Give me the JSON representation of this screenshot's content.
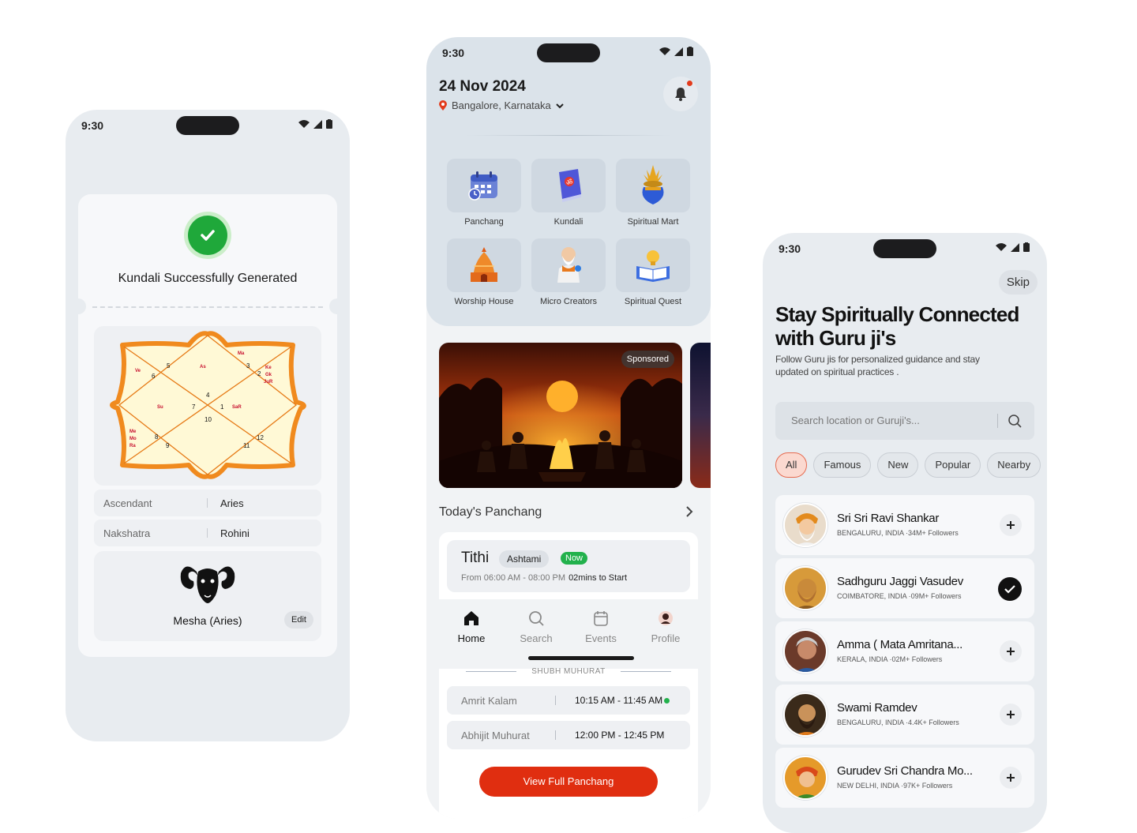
{
  "status": {
    "time": "9:30"
  },
  "kundali": {
    "title": "Kundali Successfully Generated",
    "rows": [
      {
        "label": "Ascendant",
        "value": "Aries"
      },
      {
        "label": "Nakshatra",
        "value": "Rohini"
      }
    ],
    "sign": "Mesha (Aries)",
    "edit_label": "Edit",
    "houses": [
      "1",
      "2",
      "3",
      "4",
      "5",
      "6",
      "7",
      "8",
      "9",
      "10",
      "11",
      "12"
    ],
    "planets": [
      "Ma",
      "Ve",
      "As",
      "Ke",
      "Gk",
      "JuR",
      "Su",
      "SaR",
      "Me",
      "Mo",
      "Ra"
    ]
  },
  "home": {
    "date": "24 Nov 2024",
    "location": "Bangalore, Karnataka",
    "tiles": [
      {
        "label": "Panchang",
        "icon": "calendar-icon"
      },
      {
        "label": "Kundali",
        "icon": "book-icon"
      },
      {
        "label": "Spiritual Mart",
        "icon": "kalash-icon"
      },
      {
        "label": "Worship House",
        "icon": "temple-icon"
      },
      {
        "label": "Micro Creators",
        "icon": "guru-figure-icon"
      },
      {
        "label": "Spiritual Quest",
        "icon": "quest-book-icon"
      }
    ],
    "sponsored": "Sponsored",
    "panchang_title": "Today's Panchang",
    "tithi": {
      "label": "Tithi",
      "value": "Ashtami",
      "now": "Now",
      "time": "From 06:00 AM - 08:00 PM",
      "start": "02mins to Start"
    },
    "nav": [
      {
        "label": "Home",
        "icon": "home-icon",
        "active": true
      },
      {
        "label": "Search",
        "icon": "search-icon",
        "active": false
      },
      {
        "label": "Events",
        "icon": "calendar-icon",
        "active": false
      },
      {
        "label": "Profile",
        "icon": "avatar-icon",
        "active": false
      }
    ],
    "shubh_label": "SHUBH MUHURAT",
    "muhurat": [
      {
        "label": "Amrit Kalam",
        "value": "10:15 AM - 11:45 AM",
        "live": true
      },
      {
        "label": "Abhijit Muhurat",
        "value": "12:00 PM - 12:45 PM",
        "live": false
      }
    ],
    "view_btn": "View Full Panchang"
  },
  "gurus": {
    "skip": "Skip",
    "title": "Stay Spiritually Connected with Guru ji's",
    "subtitle": "Follow Guru jis for personalized guidance and stay updated on spiritual practices .",
    "search_placeholder": "Search location or Guruji's...",
    "filters": [
      "All",
      "Famous",
      "New",
      "Popular",
      "Nearby"
    ],
    "list": [
      {
        "name": "Sri Sri Ravi Shankar",
        "meta": "BENGALURU, INDIA ·34M+ Followers",
        "followed": false,
        "avatar_color": "#e9dccb"
      },
      {
        "name": "Sadhguru Jaggi Vasudev",
        "meta": "COIMBATORE, INDIA ·09M+ Followers",
        "followed": true,
        "avatar_color": "#d79a3a"
      },
      {
        "name": "Amma ( Mata Amritana...",
        "meta": "KERALA, INDIA ·02M+ Followers",
        "followed": false,
        "avatar_color": "#6b3a2a"
      },
      {
        "name": "Swami Ramdev",
        "meta": "BENGALURU, INDIA ·4.4K+ Followers",
        "followed": false,
        "avatar_color": "#7a4a20"
      },
      {
        "name": "Gurudev Sri Chandra Mo...",
        "meta": "NEW DELHI, INDIA ·97K+ Followers",
        "followed": false,
        "avatar_color": "#e59a2a"
      }
    ]
  }
}
